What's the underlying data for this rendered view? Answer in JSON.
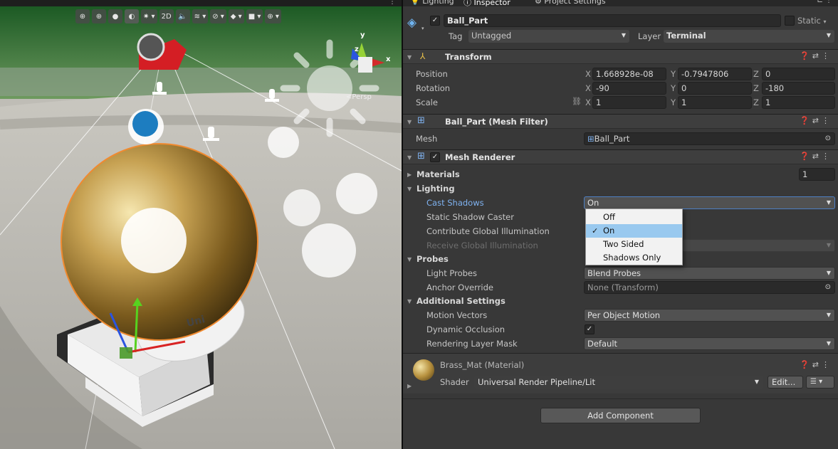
{
  "tabs": {
    "lighting": "Lighting",
    "inspector": "Inspector",
    "project_settings": "Project Settings"
  },
  "scene": {
    "toolbar": {
      "btn_2d": "2D"
    },
    "persp_label": "<Persp",
    "gizmo_axes": {
      "x": "x",
      "y": "y",
      "z": "z"
    },
    "plate_text": "Uni"
  },
  "object": {
    "name": "Ball_Part",
    "static_label": "Static",
    "tag_label": "Tag",
    "tag_value": "Untagged",
    "layer_label": "Layer",
    "layer_value": "Terminal"
  },
  "transform": {
    "title": "Transform",
    "position": {
      "label": "Position",
      "x": "1.668928e-08",
      "y": "-0.7947806",
      "z": "0"
    },
    "rotation": {
      "label": "Rotation",
      "x": "-90",
      "y": "0",
      "z": "-180"
    },
    "scale": {
      "label": "Scale",
      "x": "1",
      "y": "1",
      "z": "1"
    },
    "axis_x": "X",
    "axis_y": "Y",
    "axis_z": "Z"
  },
  "mesh_filter": {
    "title": "Ball_Part (Mesh Filter)",
    "mesh_label": "Mesh",
    "mesh_value": "Ball_Part"
  },
  "mesh_renderer": {
    "title": "Mesh Renderer",
    "materials_label": "Materials",
    "materials_count": "1",
    "lighting_label": "Lighting",
    "cast_shadows_label": "Cast Shadows",
    "cast_shadows_value": "On",
    "static_shadow_caster_label": "Static Shadow Caster",
    "contribute_gi_label": "Contribute Global Illumination",
    "receive_gi_label": "Receive Global Illumination",
    "probes_label": "Probes",
    "light_probes_label": "Light Probes",
    "light_probes_value": "Blend Probes",
    "anchor_override_label": "Anchor Override",
    "anchor_override_value": "None (Transform)",
    "additional_label": "Additional Settings",
    "motion_vectors_label": "Motion Vectors",
    "motion_vectors_value": "Per Object Motion",
    "dynamic_occlusion_label": "Dynamic Occlusion",
    "rendering_layer_mask_label": "Rendering Layer Mask",
    "rendering_layer_mask_value": "Default"
  },
  "dropdown_options": [
    "Off",
    "On",
    "Two Sided",
    "Shadows Only"
  ],
  "material": {
    "title": "Brass_Mat (Material)",
    "shader_label": "Shader",
    "shader_value": "Universal Render Pipeline/Lit",
    "edit_label": "Edit..."
  },
  "add_component_label": "Add Component",
  "colors": {
    "inspector_bg": "#383838",
    "selection_blue": "#99c9ef",
    "highlight_label": "#7fb2f0",
    "selection_outline": "#f08a30"
  }
}
